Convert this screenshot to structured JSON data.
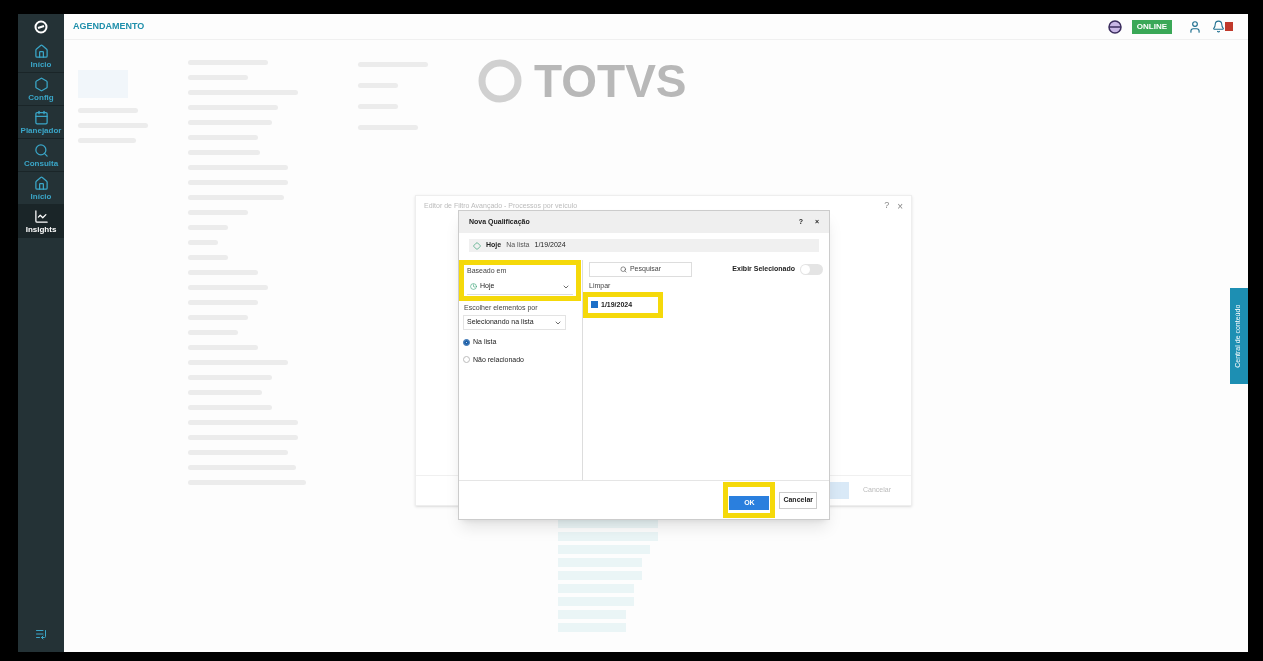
{
  "app": {
    "title": "AGENDAMENTO",
    "status": "ONLINE",
    "logo": "TOTVS"
  },
  "nav": [
    {
      "label": "Início",
      "selected": false
    },
    {
      "label": "Config",
      "selected": false
    },
    {
      "label": "Planejador",
      "selected": false
    },
    {
      "label": "Consulta",
      "selected": false
    },
    {
      "label": "Início",
      "selected": false
    },
    {
      "label": "Insights",
      "selected": true
    }
  ],
  "side_tab": "Central de conteúdo",
  "editor_dialog": {
    "title": "Editor de Filtro Avançado - Processos por veículo",
    "help": "?",
    "close": "×",
    "cancel": "Cancelar"
  },
  "dialog": {
    "title": "Nova Qualificação",
    "help": "?",
    "close": "×",
    "summary": {
      "attribute": "Hoje",
      "operator": "Na lista",
      "value": "1/19/2024"
    },
    "based_on": {
      "label": "Baseado em",
      "value": "Hoje"
    },
    "choose_by": {
      "label": "Escolher elementos por",
      "value": "Selecionando na lista"
    },
    "options": [
      {
        "label": "Na lista",
        "selected": true
      },
      {
        "label": "Não relacionado",
        "selected": false
      }
    ],
    "search": "Pesquisar",
    "show_selected": {
      "label": "Exibir Selecionado",
      "on": false
    },
    "clear": "Limpar",
    "elements": [
      {
        "label": "1/19/2024",
        "checked": true
      }
    ],
    "ok": "OK",
    "cancel": "Cancelar"
  }
}
